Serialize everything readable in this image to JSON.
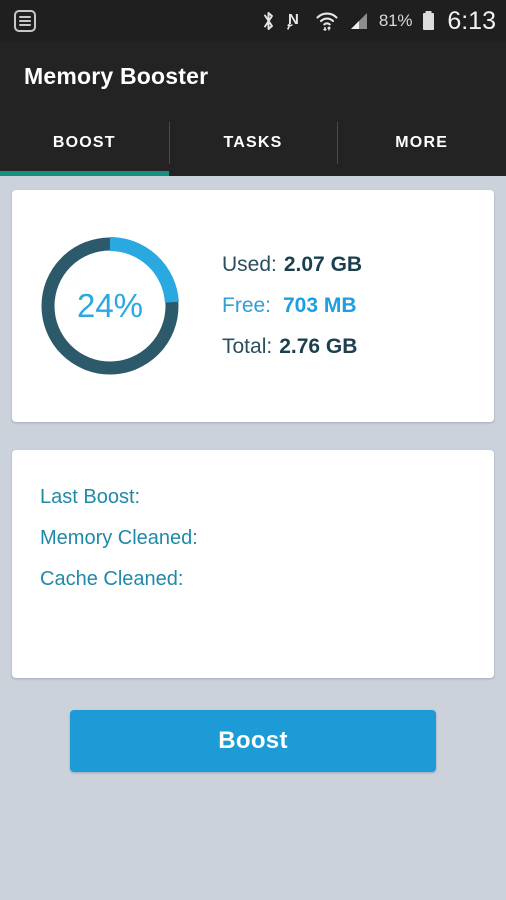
{
  "statusbar": {
    "notification_icon": "list-notification-icon",
    "icons": [
      "bluetooth-icon",
      "nfc-icon",
      "wifi-icon",
      "cellular-signal-icon"
    ],
    "battery_percent": "81%",
    "battery_icon": "battery-icon",
    "clock": "6:13"
  },
  "header": {
    "title": "Memory Booster"
  },
  "tabs": [
    {
      "label": "BOOST",
      "active": true
    },
    {
      "label": "TASKS",
      "active": false
    },
    {
      "label": "MORE",
      "active": false
    }
  ],
  "memory_card": {
    "percent_label": "24%",
    "percent_value": 24,
    "stats": [
      {
        "key": "Used:",
        "value": "2.07 GB",
        "highlight": false
      },
      {
        "key": "Free:",
        "value": "703 MB",
        "highlight": true
      },
      {
        "key": "Total:",
        "value": "2.76 GB",
        "highlight": false
      }
    ]
  },
  "boost_info_card": {
    "rows": [
      {
        "key": "Last Boost:",
        "value": ""
      },
      {
        "key": "Memory Cleaned:",
        "value": ""
      },
      {
        "key": "Cache Cleaned:",
        "value": ""
      }
    ]
  },
  "boost_button": {
    "label": "Boost"
  },
  "colors": {
    "accent_blue": "#1d9bd7",
    "donut_arc": "#29a9e0",
    "donut_track": "#2d5a6b",
    "tab_indicator": "#18907f",
    "page_background": "#ccd2dc",
    "bar_background": "#232323"
  }
}
